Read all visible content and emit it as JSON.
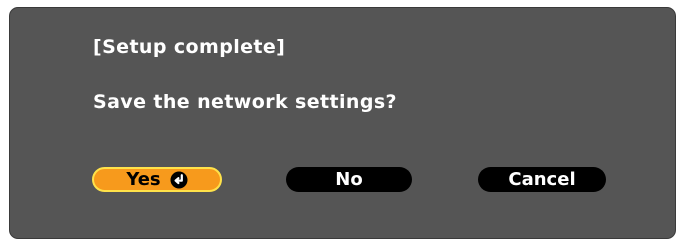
{
  "dialog": {
    "title": "[Setup complete]",
    "prompt": "Save the network settings?",
    "buttons": {
      "yes": "Yes",
      "no": "No",
      "cancel": "Cancel"
    },
    "selected_button": "yes",
    "yes_icon": "enter-icon"
  },
  "colors": {
    "dialog_background": "#555555",
    "text": "#ffffff",
    "selected_button": "#f79a1c",
    "selected_button_border": "#ffe24a",
    "button": "#000000"
  }
}
